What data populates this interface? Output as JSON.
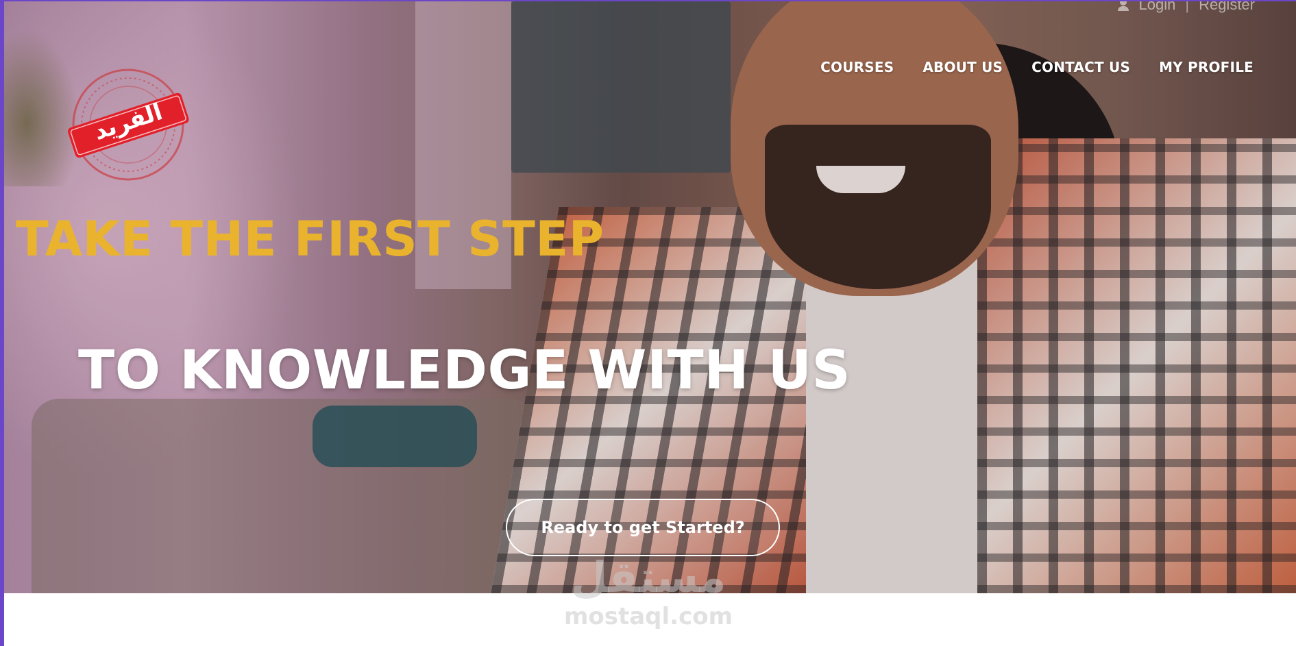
{
  "top_utility": {
    "login_label": "Login",
    "separator": "|",
    "register_label": "Register",
    "icon": "user-icon"
  },
  "nav": {
    "items": [
      {
        "label": "COURSES"
      },
      {
        "label": "ABOUT US"
      },
      {
        "label": "CONTACT US"
      },
      {
        "label": "MY PROFILE"
      }
    ]
  },
  "logo": {
    "stamp_text": "الفريد",
    "stamp_color": "#e2202a"
  },
  "hero": {
    "headline_primary": "TAKE THE FIRST STEP",
    "headline_secondary": "TO KNOWLEDGE WITH US",
    "cta_label": "Ready to get Started?",
    "accent_color": "#eab32e"
  },
  "watermark": {
    "arabic": "مستقل",
    "latin": "mostaql.com"
  },
  "colors": {
    "frame_border": "#6b46c8",
    "nav_text": "#ffffff",
    "headline_secondary": "#ffffff"
  }
}
